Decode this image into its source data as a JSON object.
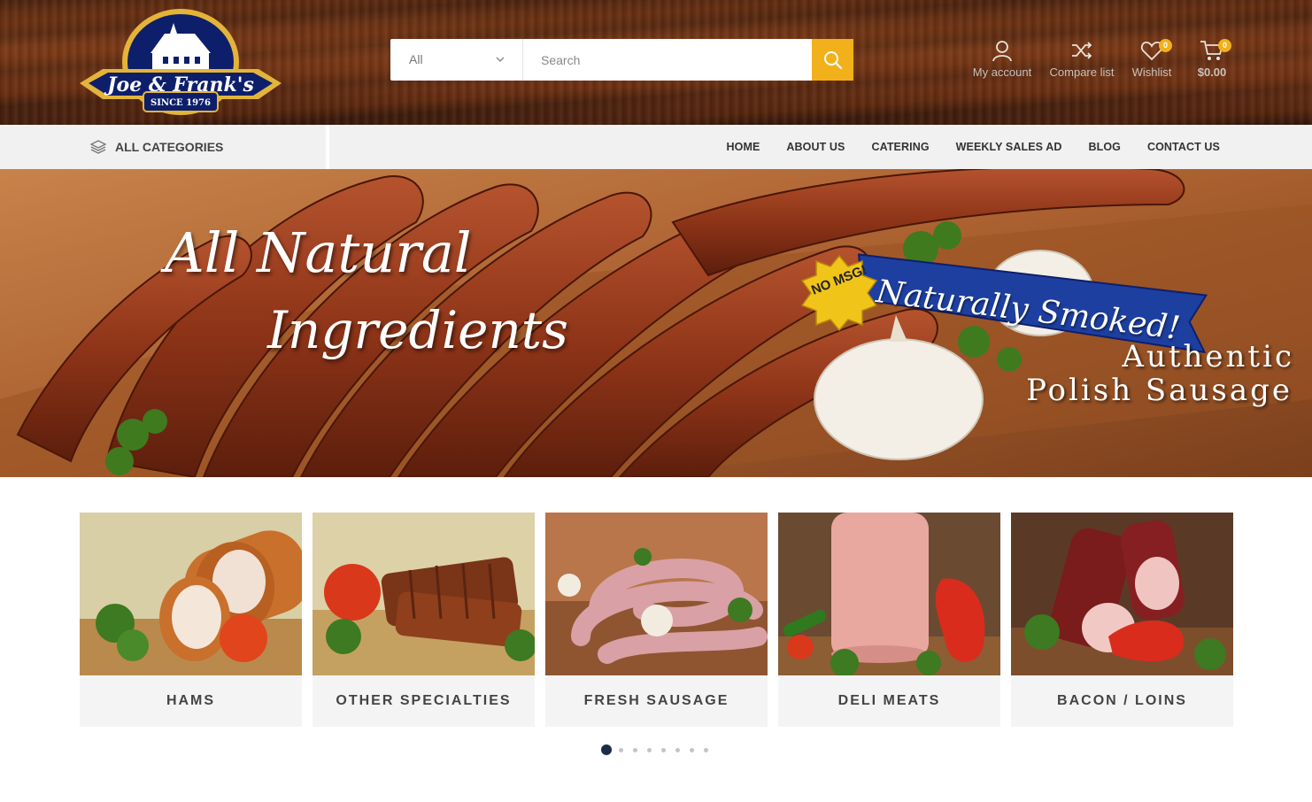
{
  "brand": {
    "logo_name": "Joe & Frank's",
    "logo_tagline": "SINCE 1976"
  },
  "search": {
    "category_selected": "All",
    "placeholder": "Search"
  },
  "header_icons": {
    "account_label": "My account",
    "compare_label": "Compare list",
    "wishlist_label": "Wishlist",
    "wishlist_count": "0",
    "cart_total": "$0.00",
    "cart_count": "0"
  },
  "nav": {
    "all_categories": "ALL CATEGORIES",
    "links": [
      "HOME",
      "ABOUT US",
      "CATERING",
      "WEEKLY SALES AD",
      "BLOG",
      "CONTACT US"
    ]
  },
  "hero": {
    "title_line1": "All Natural",
    "title_line2": "Ingredients",
    "badge_text": "NO MSG!",
    "ribbon_text": "Naturally Smoked!",
    "sub_line1": "Authentic",
    "sub_line2": "Polish Sausage"
  },
  "categories": [
    {
      "label": "HAMS"
    },
    {
      "label": "OTHER SPECIALTIES"
    },
    {
      "label": "FRESH SAUSAGE"
    },
    {
      "label": "DELI MEATS"
    },
    {
      "label": "BACON / LOINS"
    }
  ],
  "carousel": {
    "page_count": 8,
    "active_index": 0
  },
  "colors": {
    "accent": "#f2b11b",
    "nav_bg": "#f1f1f1",
    "active_dot": "#1e2a4a"
  }
}
